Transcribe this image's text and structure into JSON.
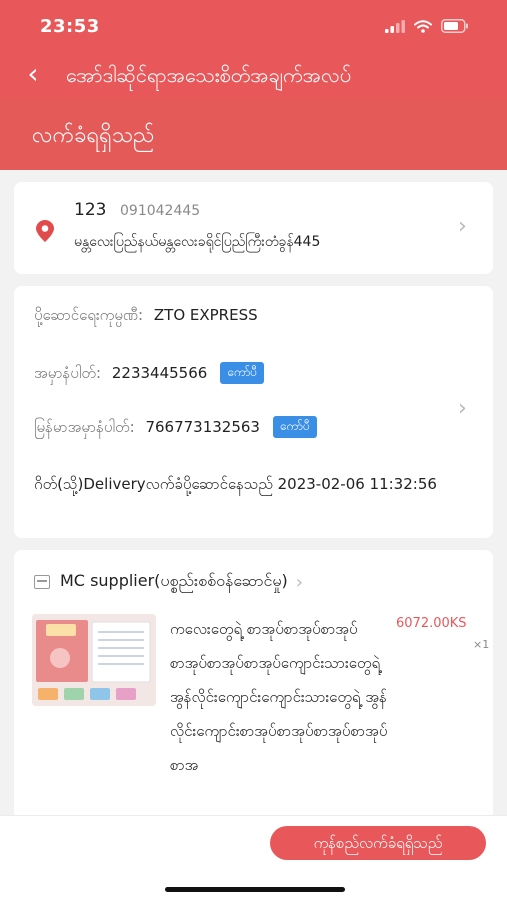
{
  "status_bar": {
    "time": "23:53"
  },
  "nav": {
    "title": "အော်ဒါဆိုင်ရာအသေးစိတ်အချက်အလပ်"
  },
  "order_status": {
    "title": "လက်ခံရရှိသည်"
  },
  "address": {
    "name": "123",
    "phone": "091042445",
    "detail": "မန္တလေးပြည်နယ်မန္တလေးခရိုင်ပြည်ကြီးတံခွန်445"
  },
  "logistics": {
    "company_label": "ပို့ဆောင်ရေးကုမ္ပဏီ:",
    "company_value": "ZTO EXPRESS",
    "tracking_label": "အမှာနံပါတ်:",
    "tracking_value": "2233445566",
    "mm_tracking_label": "မြန်မာအမှာနံပါတ်:",
    "mm_tracking_value": "766773132563",
    "copy_label": "ကော်ပီ",
    "status_text": "ဂိတ်(သို့)Deliveryလက်ခံပို့ဆောင်နေသည်  2023-02-06 11:32:56"
  },
  "order": {
    "shop_name": "MC supplier(ပစ္စည်းစစ်ဝန်ဆောင်မှု)",
    "product": {
      "name": "ကလေးတွေရဲ့ စာအုပ်စာအုပ်စာအုပ်စာအုပ်စာအုပ်စာအုပ်ကျောင်းသားတွေရဲ့ အွန်လိုင်းကျောင်းကျောင်းသားတွေရဲ့ အွန်လိုင်းကျောင်းစာအုပ်စာအုပ်စာအုပ်စာအုပ်စာအ",
      "price": "6072.00KS",
      "quantity": "×1"
    }
  },
  "footer": {
    "confirm_label": "ကုန်စည်လက်ခံရရှိသည်"
  },
  "colors": {
    "accent": "#e8585a",
    "copy_button": "#3a8ee6"
  }
}
